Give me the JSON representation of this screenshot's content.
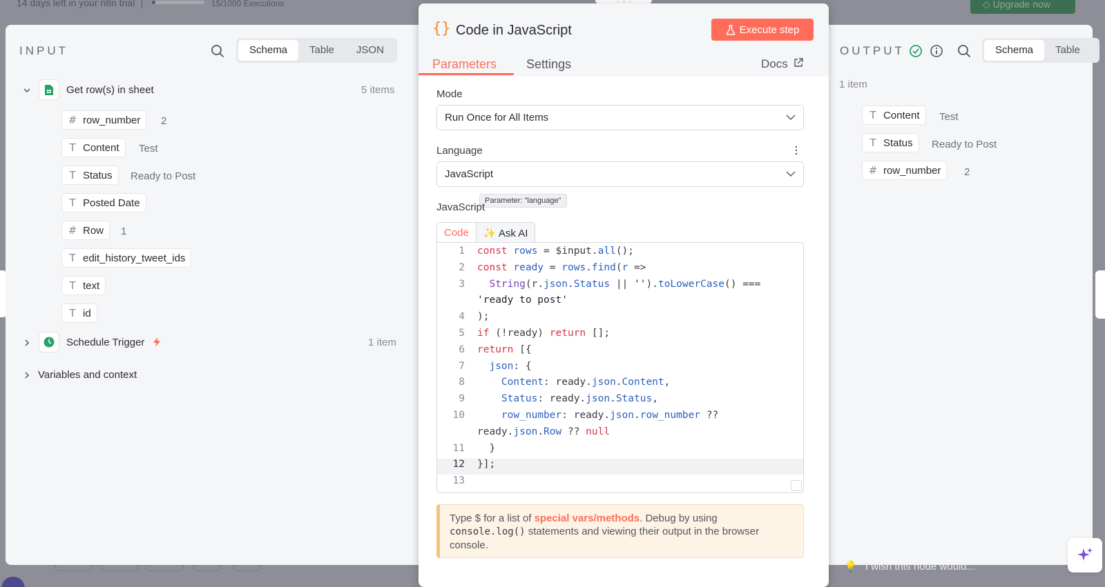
{
  "background": {
    "trial_text": "14 days left in your n8n trial",
    "executions": "15/1000 Executions",
    "upgrade_label": "Upgrade now"
  },
  "input_panel": {
    "title": "INPUT",
    "view_tabs": [
      "Schema",
      "Table",
      "JSON"
    ],
    "active_view": "Schema",
    "nodes": [
      {
        "name": "Get row(s) in sheet",
        "count": "5 items",
        "expanded": true
      },
      {
        "name": "Schedule Trigger",
        "count": "1 item",
        "expanded": false
      }
    ],
    "fields": [
      {
        "type": "#",
        "name": "row_number",
        "value": "2"
      },
      {
        "type": "T",
        "name": "Content",
        "value": "Test"
      },
      {
        "type": "T",
        "name": "Status",
        "value": "Ready to Post"
      },
      {
        "type": "T",
        "name": "Posted Date",
        "value": ""
      },
      {
        "type": "#",
        "name": "Row",
        "value": "1"
      },
      {
        "type": "T",
        "name": "edit_history_tweet_ids",
        "value": ""
      },
      {
        "type": "T",
        "name": "text",
        "value": ""
      },
      {
        "type": "T",
        "name": "id",
        "value": ""
      }
    ],
    "variables_label": "Variables and context"
  },
  "modal": {
    "title": "Code in JavaScript",
    "execute_label": "Execute step",
    "tabs": [
      "Parameters",
      "Settings"
    ],
    "active_tab": "Parameters",
    "docs_label": "Docs",
    "mode_label": "Mode",
    "mode_value": "Run Once for All Items",
    "language_label": "Language",
    "language_value": "JavaScript",
    "tooltip": "Parameter: \"language\"",
    "code_label": "JavaScript",
    "code_tabs": [
      "Code",
      "✨ Ask AI"
    ],
    "code_lines": [
      "const rows = $input.all();",
      "const ready = rows.find(r =>",
      "  String(r.json.Status || '').toLowerCase() ===",
      "'ready to post'",
      ");",
      "if (!ready) return [];",
      "return [{",
      "  json: {",
      "    Content: ready.json.Content,",
      "    Status: ready.json.Status,",
      "    row_number: ready.json.row_number ??",
      "ready.json.Row ?? null",
      "  }",
      "}];",
      ""
    ],
    "line_numbers": [
      "1",
      "2",
      "3",
      "",
      "4",
      "5",
      "6",
      "7",
      "8",
      "9",
      "10",
      "",
      "11",
      "12",
      "13"
    ],
    "current_line": "12",
    "hint_prefix": "Type $ for a list of ",
    "hint_link": "special vars/methods",
    "hint_mid": ". Debug by using ",
    "hint_code": "console.log()",
    "hint_suffix": " statements and viewing their output in the browser console."
  },
  "output_panel": {
    "title": "OUTPUT",
    "view_tabs": [
      "Schema",
      "Table"
    ],
    "active_view": "Schema",
    "count": "1 item",
    "fields": [
      {
        "type": "T",
        "name": "Content",
        "value": "Test"
      },
      {
        "type": "T",
        "name": "Status",
        "value": "Ready to Post"
      },
      {
        "type": "#",
        "name": "row_number",
        "value": "2"
      }
    ],
    "wish_text": "I wish this node would..."
  },
  "colors": {
    "accent": "#ff6d5a",
    "success": "#29a36a",
    "braces": "#f08d2d"
  }
}
